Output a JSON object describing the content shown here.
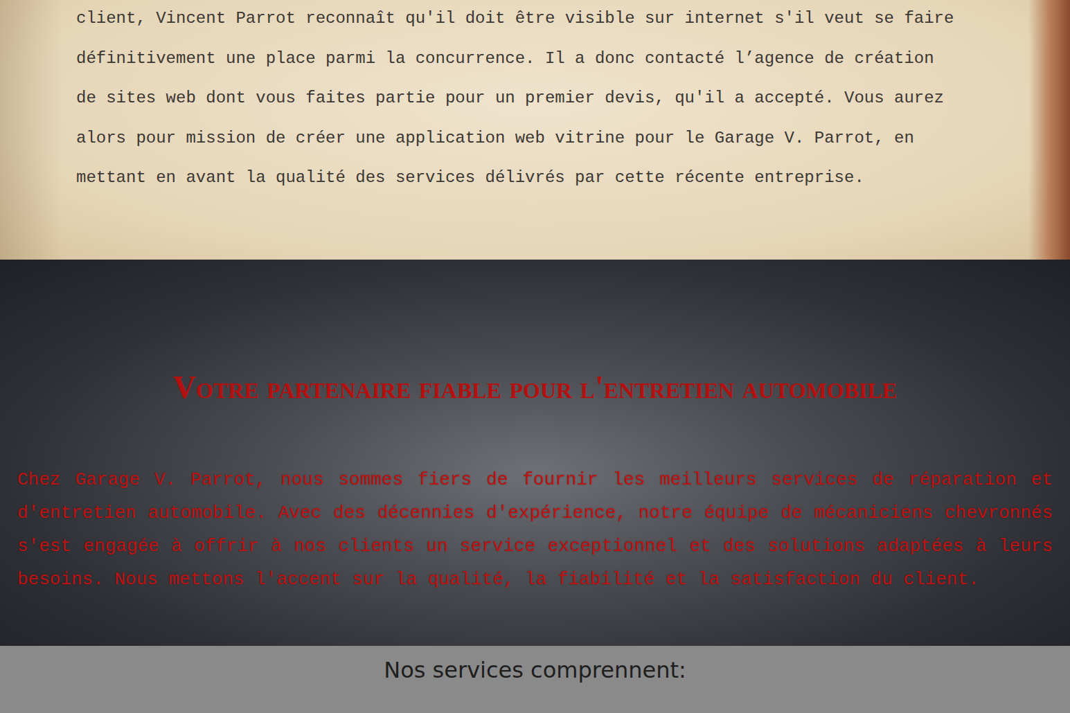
{
  "intro": {
    "lines": [
      "client, Vincent Parrot reconnaît qu'il doit être visible sur internet s'il veut se faire",
      "définitivement une place parmi la concurrence. Il a donc contacté l’agence de création",
      "de sites web dont vous faites partie pour un premier devis, qu'il a accepté. Vous aurez",
      "alors pour mission de créer une application web vitrine pour le Garage V. Parrot, en",
      "mettant en avant la qualité des services délivrés par cette récente entreprise."
    ]
  },
  "hero": {
    "title": "Votre partenaire fiable pour l'entretien automobile",
    "text": "Chez Garage V. Parrot, nous sommes fiers de fournir les meilleurs services de réparation et d'entretien automobile. Avec des décennies d'expérience, notre équipe de mécaniciens chevronnés s'est engagée à offrir à nos clients un service exceptionnel et des solutions adaptées à leurs besoins. Nous mettons l'accent sur la qualité, la fiabilité et la satisfaction du client."
  },
  "services": {
    "heading": "Nos services comprennent:"
  }
}
